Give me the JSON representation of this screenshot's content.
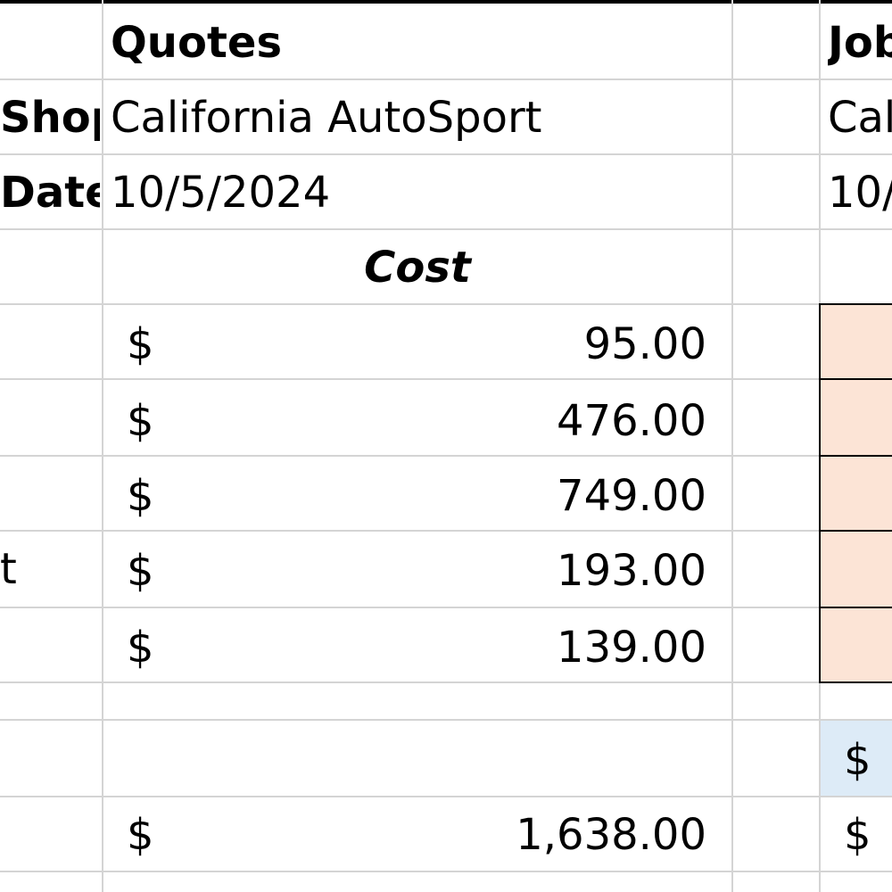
{
  "sheet": {
    "colB": {
      "header": "Quotes",
      "shop_value": "California AutoSport",
      "date_value": "10/5/2024",
      "cost_header": "Cost",
      "items": [
        {
          "currency": "$",
          "amount": "95.00"
        },
        {
          "currency": "$",
          "amount": "476.00"
        },
        {
          "currency": "$",
          "amount": "749.00"
        },
        {
          "currency": "$",
          "amount": "193.00"
        },
        {
          "currency": "$",
          "amount": "139.00"
        }
      ],
      "total": {
        "currency": "$",
        "amount": "1,638.00"
      }
    },
    "colA": {
      "shop_label": "Shop",
      "date_label": "Date",
      "row_fragment": "t"
    },
    "colD": {
      "header_partial": "Job",
      "shop_partial": "Cal",
      "date_partial": "10/",
      "blue_currency": "$",
      "total_currency": "$"
    }
  },
  "colors": {
    "gridline": "#d4d4d4",
    "peach_fill": "#fce4d6",
    "blue_fill": "#ddebf7"
  }
}
